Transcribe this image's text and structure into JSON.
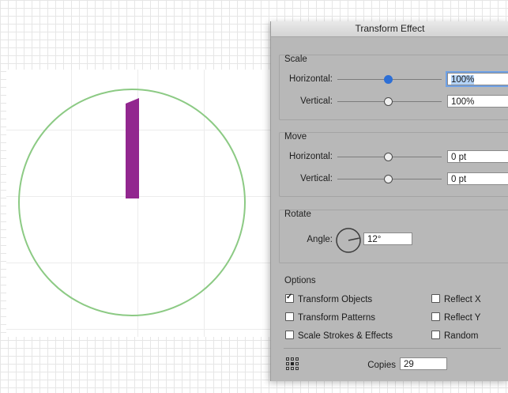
{
  "dialog": {
    "title": "Transform Effect",
    "scale": {
      "label": "Scale",
      "horizontal_label": "Horizontal:",
      "horizontal_value": "100%",
      "vertical_label": "Vertical:",
      "vertical_value": "100%"
    },
    "move": {
      "label": "Move",
      "horizontal_label": "Horizontal:",
      "horizontal_value": "0 pt",
      "vertical_label": "Vertical:",
      "vertical_value": "0 pt"
    },
    "rotate": {
      "label": "Rotate",
      "angle_label": "Angle:",
      "angle_value": "12°",
      "angle_degrees": 12
    },
    "options": {
      "label": "Options",
      "transform_objects": {
        "label": "Transform Objects",
        "checked": true
      },
      "transform_patterns": {
        "label": "Transform Patterns",
        "checked": false
      },
      "scale_strokes": {
        "label": "Scale Strokes & Effects",
        "checked": false
      },
      "reflect_x": {
        "label": "Reflect X",
        "checked": false
      },
      "reflect_y": {
        "label": "Reflect Y",
        "checked": false
      },
      "random": {
        "label": "Random",
        "checked": false
      }
    },
    "copies_label": "Copies",
    "copies_value": "29"
  },
  "colors": {
    "circle_stroke": "#8cca84",
    "shape_fill": "#92278f",
    "slider_active": "#2d6fd6"
  }
}
